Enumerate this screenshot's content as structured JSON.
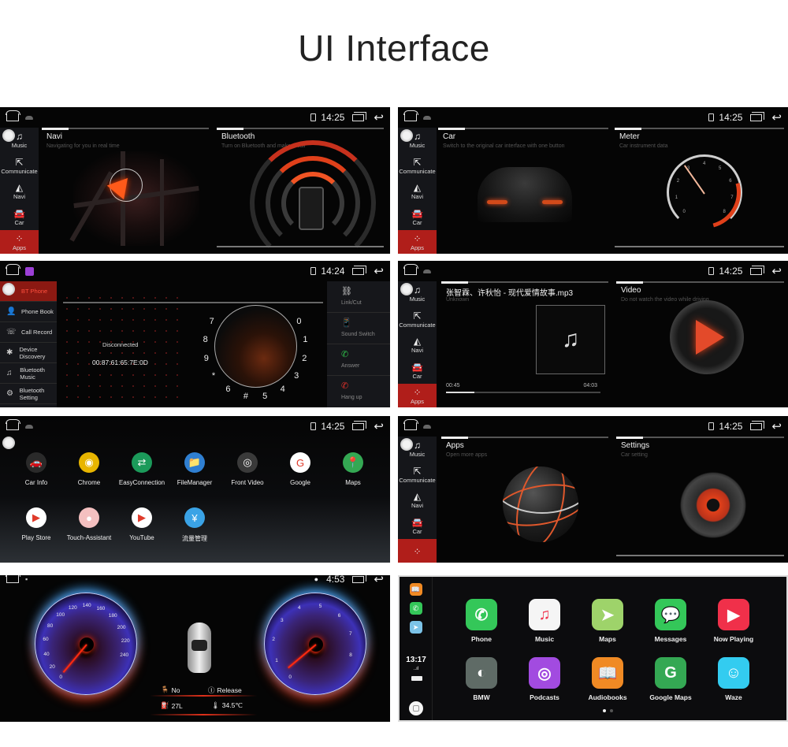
{
  "page_title": "UI Interface",
  "status": {
    "time_a": "14:25",
    "time_b": "14:24",
    "back_icon": "↩",
    "dash_time": "4:53"
  },
  "sidebar": {
    "items": [
      {
        "icon": "♫",
        "label": "Music"
      },
      {
        "icon": "⇱",
        "label": "Communicate"
      },
      {
        "icon": "◭",
        "label": "Navi"
      },
      {
        "icon": "🚘",
        "label": "Car"
      },
      {
        "icon": "⁘",
        "label": "Apps"
      }
    ],
    "active": "Apps"
  },
  "screen1": {
    "left": {
      "title": "Navi",
      "subtitle": "Navigating for you in real time"
    },
    "right": {
      "title": "Bluetooth",
      "subtitle": "Turn on Bluetooth and make a call"
    }
  },
  "screen2": {
    "left": {
      "title": "Car",
      "subtitle": "Switch to the original car interface with one button"
    },
    "right": {
      "title": "Meter",
      "subtitle": "Car instrument data",
      "scale": [
        "0",
        "1",
        "2",
        "3",
        "4",
        "5",
        "6",
        "7",
        "8"
      ]
    }
  },
  "screen3": {
    "menu": [
      {
        "icon": "",
        "label": "BT Phone",
        "active": true
      },
      {
        "icon": "👤",
        "label": "Phone Book"
      },
      {
        "icon": "☏",
        "label": "Call Record"
      },
      {
        "icon": "✱",
        "label": "Device Discovery"
      },
      {
        "icon": "♫",
        "label": "Bluetooth Music"
      },
      {
        "icon": "⚙",
        "label": "Bluetooth Setting"
      }
    ],
    "connection_status": "Disconnected",
    "device_address": "00:87:61:65:7E:0D",
    "dial_keys": [
      "7",
      "8",
      "9",
      "*",
      "6",
      "#",
      "5",
      "4",
      "3",
      "2",
      "1",
      "0"
    ],
    "actions": [
      {
        "icon": "⛓",
        "label": "Link/Cut",
        "color": "#dddddd"
      },
      {
        "icon": "📱",
        "label": "Sound Switch",
        "color": "#dddddd"
      },
      {
        "icon": "✆",
        "label": "Answer",
        "color": "#2fbf4a"
      },
      {
        "icon": "✆",
        "label": "Hang up",
        "color": "#e0302a"
      }
    ]
  },
  "screen4": {
    "music": {
      "track": "张智霖、许秋怡 - 现代爱情故事.mp3",
      "artist": "Unknown",
      "elapsed": "00:45",
      "total": "04:03",
      "progress": 0.185
    },
    "video": {
      "title": "Video",
      "subtitle": "Do not watch the video while driving"
    }
  },
  "screen5": {
    "apps": [
      {
        "label": "Car Info",
        "icon": "🚗",
        "bg": "#2a2a2a"
      },
      {
        "label": "Chrome",
        "icon": "◉",
        "bg": "#e8b500"
      },
      {
        "label": "EasyConnection",
        "icon": "⇄",
        "bg": "#1b9a5a"
      },
      {
        "label": "FileManager",
        "icon": "📁",
        "bg": "#2f7fd1"
      },
      {
        "label": "Front Video",
        "icon": "◎",
        "bg": "#3a3a3a"
      },
      {
        "label": "Google",
        "icon": "G",
        "bg": "#ffffff"
      },
      {
        "label": "Maps",
        "icon": "📍",
        "bg": "#34a853"
      },
      {
        "label": "Play Store",
        "icon": "▶",
        "bg": "#ffffff"
      },
      {
        "label": "Touch-Assistant",
        "icon": "●",
        "bg": "#f4c0c0"
      },
      {
        "label": "YouTube",
        "icon": "▶",
        "bg": "#ffffff"
      },
      {
        "label": "流量管理",
        "icon": "¥",
        "bg": "#3aa3e6"
      }
    ]
  },
  "screen6": {
    "left": {
      "title": "Apps",
      "subtitle": "Open more apps"
    },
    "right": {
      "title": "Settings",
      "subtitle": "Car setting"
    }
  },
  "screen7": {
    "speedometer": {
      "ticks": [
        "0",
        "20",
        "40",
        "60",
        "80",
        "100",
        "120",
        "140",
        "160",
        "180",
        "200",
        "220",
        "240"
      ],
      "value": 0
    },
    "tachometer": {
      "ticks": [
        "0",
        "1",
        "2",
        "3",
        "4",
        "5",
        "6",
        "7",
        "8"
      ],
      "value": 0
    },
    "seatbelt": {
      "icon": "🪑",
      "value": "No"
    },
    "parking_brake": {
      "icon": "Ⓘ",
      "value": "Release"
    },
    "fuel": {
      "icon": "⛽",
      "value": "27L"
    },
    "temperature": {
      "icon": "🌡",
      "value": "34.5℃"
    }
  },
  "screen8": {
    "side_apps": [
      {
        "icon": "📖",
        "bg": "#f08a24"
      },
      {
        "icon": "✆",
        "bg": "#34c759"
      },
      {
        "icon": "➤",
        "bg": "#7cc3e8"
      }
    ],
    "time": "13:17",
    "signal": "..ıl",
    "apps": [
      {
        "label": "Phone",
        "icon": "✆",
        "bg": "#34c759"
      },
      {
        "label": "Music",
        "icon": "♫",
        "bg": "#f5f5f5"
      },
      {
        "label": "Maps",
        "icon": "➤",
        "bg": "#9ed36a"
      },
      {
        "label": "Messages",
        "icon": "💬",
        "bg": "#34c759"
      },
      {
        "label": "Now Playing",
        "icon": "▶",
        "bg": "#f0304a"
      },
      {
        "label": "BMW",
        "icon": "◐",
        "bg": "#5f6b66"
      },
      {
        "label": "Podcasts",
        "icon": "◎",
        "bg": "#a24be0"
      },
      {
        "label": "Audiobooks",
        "icon": "📖",
        "bg": "#f08a24"
      },
      {
        "label": "Google Maps",
        "icon": "G",
        "bg": "#34a853"
      },
      {
        "label": "Waze",
        "icon": "☺",
        "bg": "#33ccf0"
      }
    ],
    "pages": 2,
    "current_page": 1
  }
}
